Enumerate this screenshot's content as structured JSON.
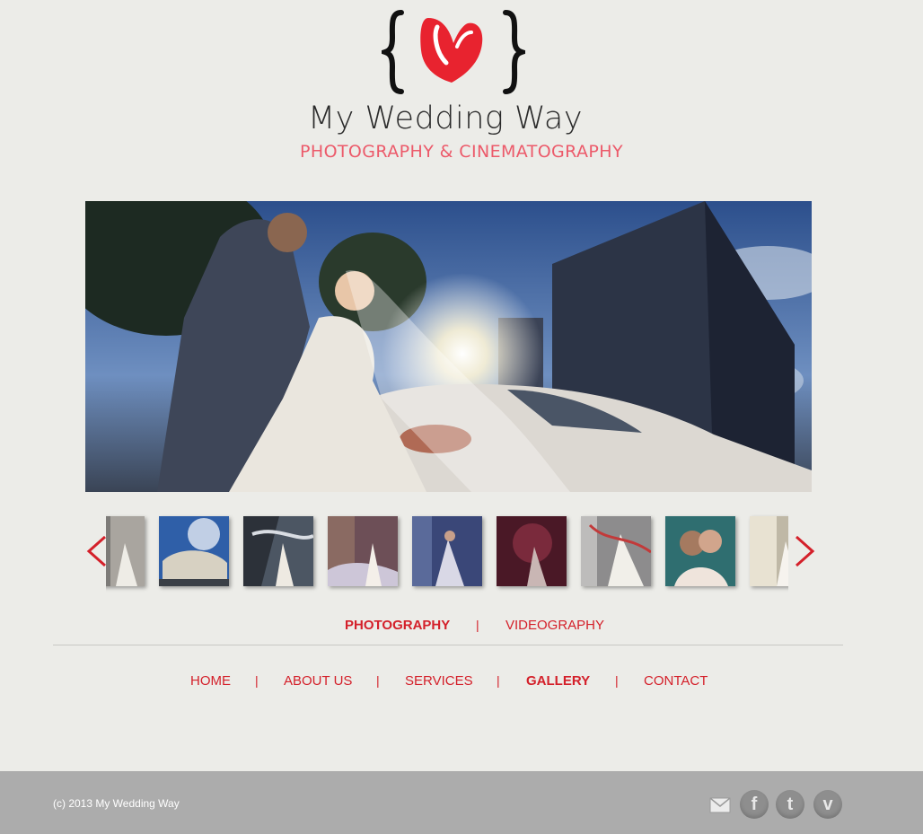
{
  "brand": {
    "logo_title": "My Wedding Way",
    "logo_subtitle": "PHOTOGRAPHY & CINEMATOGRAPHY",
    "accent_color": "#d4202a",
    "logo_accent_color": "#e8232f"
  },
  "carousel": {
    "prev_icon": "chevron-left-icon",
    "next_icon": "chevron-right-icon",
    "thumbnail_count": 9
  },
  "gallery_tabs": [
    {
      "label": "PHOTOGRAPHY",
      "active": true
    },
    {
      "label": "VIDEOGRAPHY",
      "active": false
    }
  ],
  "separator": "|",
  "nav": [
    {
      "label": "HOME",
      "active": false
    },
    {
      "label": "ABOUT US",
      "active": false
    },
    {
      "label": "SERVICES",
      "active": false
    },
    {
      "label": "GALLERY",
      "active": true
    },
    {
      "label": "CONTACT",
      "active": false
    }
  ],
  "footer": {
    "copyright": "(c) 2013 My Wedding Way",
    "background": "#acacac",
    "social_icons": [
      "mail-icon",
      "facebook-icon",
      "twitter-icon",
      "vimeo-icon"
    ],
    "facebook_glyph": "f",
    "twitter_glyph": "t",
    "vimeo_glyph": "v"
  }
}
